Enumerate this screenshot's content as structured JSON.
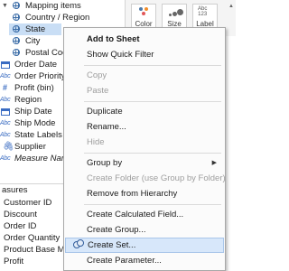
{
  "data_pane": {
    "mapping_items": "Mapping items",
    "country_region": "Country / Region",
    "state": "State",
    "city": "City",
    "postal_code": "Postal Coo",
    "dimensions": [
      {
        "type": "calendar-icon",
        "label": "Order Date"
      },
      {
        "type": "abc-icon",
        "label": "Order Priority"
      },
      {
        "type": "hash-icon",
        "label": "Profit (bin)"
      },
      {
        "type": "abc-icon",
        "label": "Region"
      },
      {
        "type": "calendar-icon",
        "label": "Ship Date"
      },
      {
        "type": "abc-icon",
        "label": "Ship Mode"
      },
      {
        "type": "abc-icon",
        "label": "State Labels"
      },
      {
        "type": "paperclip-icon",
        "label": "Supplier"
      },
      {
        "type": "abc-icon",
        "label": "Measure Nam"
      }
    ],
    "measures_header": "asures",
    "measures": [
      "Customer ID",
      "Discount",
      "Order ID",
      "Order Quantity",
      "Product Base Ma",
      "Profit"
    ]
  },
  "marks_card": {
    "color": "Color",
    "size": "Size",
    "label": "Label",
    "label_glyph": "Abc\n123"
  },
  "context_menu": {
    "items": [
      {
        "label": "Add to Sheet",
        "style": "bold"
      },
      {
        "label": "Show Quick Filter",
        "style": "normal"
      },
      {
        "label": "Copy",
        "style": "disabled"
      },
      {
        "label": "Paste",
        "style": "disabled"
      },
      {
        "label": "Duplicate",
        "style": "normal"
      },
      {
        "label": "Rename...",
        "style": "normal"
      },
      {
        "label": "Hide",
        "style": "disabled"
      },
      {
        "label": "Group by",
        "style": "submenu"
      },
      {
        "label": "Create Folder (use Group by Folder)",
        "style": "disabled"
      },
      {
        "label": "Remove from Hierarchy",
        "style": "normal"
      },
      {
        "label": "Create Calculated Field...",
        "style": "normal"
      },
      {
        "label": "Create Group...",
        "style": "normal"
      },
      {
        "label": "Create Set...",
        "style": "highlighted"
      },
      {
        "label": "Create Parameter...",
        "style": "normal"
      }
    ]
  },
  "colors": {
    "selection": "#c9def5",
    "menu_highlight": "#d7e7fa",
    "field_icon_blue": "#3a6cc2",
    "disabled_text": "#9e9e9e"
  }
}
